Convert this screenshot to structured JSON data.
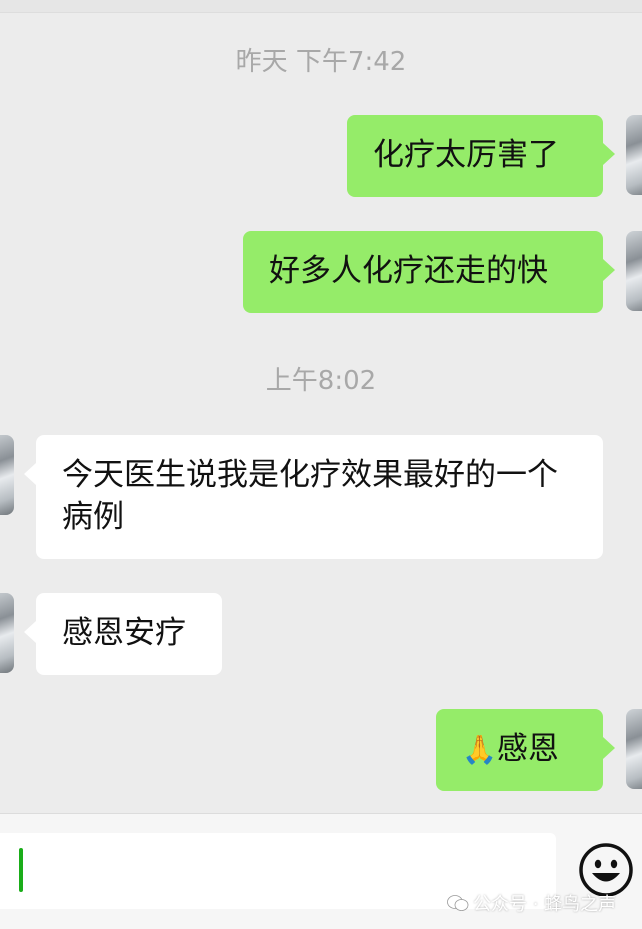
{
  "chat": {
    "timestamps": [
      "昨天 下午7:42",
      "上午8:02"
    ],
    "messages": [
      {
        "side": "sent",
        "text": "化疗太厉害了"
      },
      {
        "side": "sent",
        "text": "好多人化疗还走的快"
      },
      {
        "side": "recv",
        "text": "今天医生说我是化疗效果最好的一个病例"
      },
      {
        "side": "recv",
        "text": "感恩安疗"
      },
      {
        "side": "sent",
        "emoji": "🙏",
        "text": "感恩"
      }
    ]
  },
  "input": {
    "value": "",
    "emoji_icon": "smiley-face-icon"
  },
  "watermark": {
    "icon": "wechat-official-account-icon",
    "text": "公众号 · 蜂鸟之声"
  },
  "colors": {
    "sent_bubble": "#95ec69",
    "received_bubble": "#ffffff",
    "background": "#ececec",
    "caret": "#1aad19"
  }
}
